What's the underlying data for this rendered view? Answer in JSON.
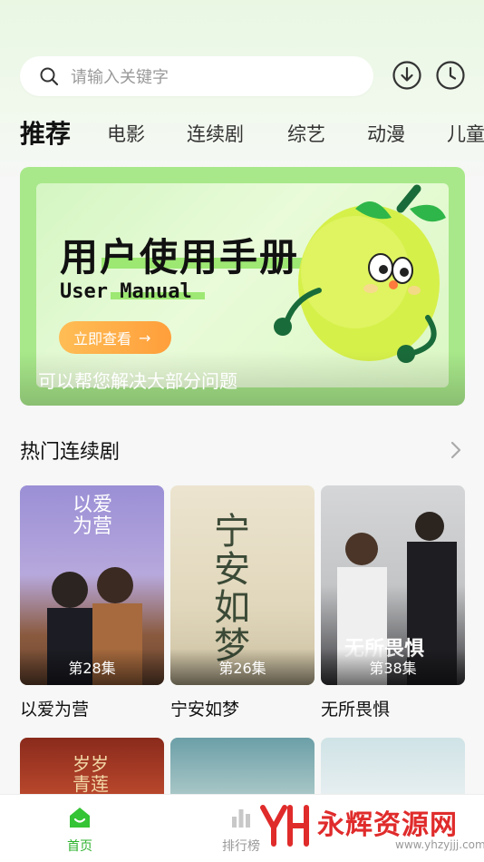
{
  "search": {
    "placeholder": "请输入关键字"
  },
  "tabs": [
    {
      "label": "推荐",
      "active": true
    },
    {
      "label": "电影"
    },
    {
      "label": "连续剧"
    },
    {
      "label": "综艺"
    },
    {
      "label": "动漫"
    },
    {
      "label": "儿童"
    }
  ],
  "banner": {
    "title": "用户使用手册",
    "subtitle": "User Manual",
    "button": "立即查看",
    "caption": "可以帮您解决大部分问题"
  },
  "section": {
    "title": "热门连续剧"
  },
  "dramas": [
    {
      "name": "以爱为营",
      "episode": "第28集",
      "poster_text": "以爱为营"
    },
    {
      "name": "宁安如梦",
      "episode": "第26集",
      "poster_text": "宁安如梦"
    },
    {
      "name": "无所畏惧",
      "episode": "第38集",
      "poster_text": "无所畏惧"
    }
  ],
  "row2": {
    "poster_text": "岁岁青莲"
  },
  "nav": [
    {
      "label": "首页",
      "icon": "home-icon",
      "active": true
    },
    {
      "label": "排行榜",
      "icon": "chart-icon"
    }
  ],
  "watermark": {
    "brand": "永辉资源网",
    "url": "www.yhzyjjj.com"
  },
  "colors": {
    "accent": "#2db22d",
    "banner_green": "#a8e88a",
    "button_orange": "#ff9f3b",
    "watermark_red": "#e02b2b"
  }
}
